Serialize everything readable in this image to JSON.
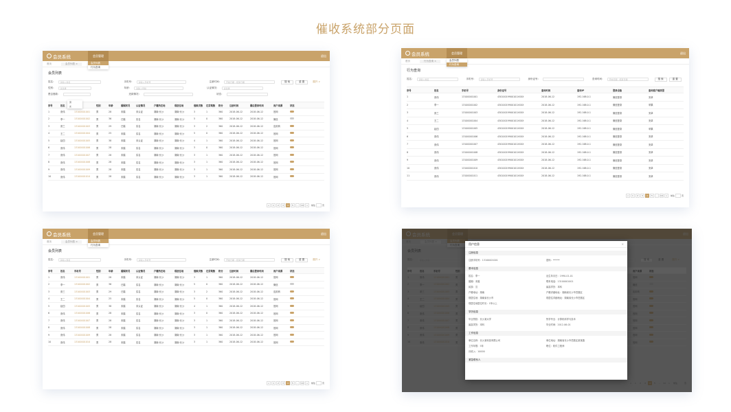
{
  "page_title": "催收系统部分页面",
  "app_name": "会员系统",
  "nav_label": "会员管理",
  "menu": [
    "会员列表",
    "行为查询"
  ],
  "header_right": "退出",
  "tabs": [
    "首页",
    "会员列表 ×"
  ],
  "tabs2": [
    "首页",
    "行为查询 ×"
  ],
  "list_title": "会员列表",
  "behavior_title": "行为查询",
  "filters": {
    "name": "姓名：",
    "name_ph": "请输入姓名",
    "phone": "手机号：",
    "phone_ph": "请输入手机号",
    "reg_time": "注册时间：",
    "reg_ph": "开始日期 - 结束日期",
    "gender": "性别：",
    "gender_ph": "请选择",
    "age": "年龄：",
    "age_ph": "请输入年龄",
    "auth": "认证情况：",
    "auth_ph": "请选择",
    "loan": "是否借款：",
    "repay": "还款情况：",
    "status": "状态：",
    "search": "搜 索",
    "reset": "重 置",
    "expand": "展开 ∨",
    "idcard": "身份证号：",
    "query_time": "查询时间：",
    "query": "查询"
  },
  "gender_opts": [
    "男",
    "女"
  ],
  "columns": [
    "序号",
    "姓名",
    "手机号",
    "性别",
    "年龄",
    "婚姻状况",
    "认证情况",
    "户籍所在地",
    "现居住地",
    "借款次数",
    "在贷笔数",
    "积分",
    "注册时间",
    "最后登录时间",
    "用户来源",
    "状态"
  ],
  "rows": [
    [
      "1",
      "张伟",
      "13100001001",
      "男",
      "28",
      "未婚",
      "未认证",
      "湖南·长沙",
      "湖南·长沙",
      "3",
      "1",
      "360",
      "2018-06-12",
      "2018-06-12",
      "官网",
      "on"
    ],
    [
      "2",
      "李一",
      "13100001002",
      "男",
      "36",
      "已婚",
      "实名",
      "湖南·长沙",
      "湖南·长沙",
      "5",
      "0",
      "360",
      "2018-06-12",
      "2018-06-12",
      "微信",
      "off"
    ],
    [
      "3",
      "张三",
      "13100001003",
      "男",
      "29",
      "已婚",
      "实名",
      "湖南·长沙",
      "湖南·长沙",
      "3",
      "2",
      "360",
      "2018-06-12",
      "2018-06-12",
      "应用商",
      "on"
    ],
    [
      "4",
      "王二",
      "13100001004",
      "男",
      "25",
      "未婚",
      "实名",
      "湖南·长沙",
      "湖南·长沙",
      "5",
      "0",
      "360",
      "2018-06-12",
      "2018-06-12",
      "官网",
      "on"
    ],
    [
      "5",
      "赵四",
      "13100001005",
      "男",
      "38",
      "未婚",
      "未认证",
      "湖南·长沙",
      "湖南·长沙",
      "4",
      "1",
      "360",
      "2018-06-12",
      "2018-06-12",
      "官网",
      "on"
    ],
    [
      "6",
      "张伟",
      "13100001006",
      "男",
      "28",
      "未婚",
      "实名",
      "湖南·长沙",
      "湖南·长沙",
      "3",
      "0",
      "360",
      "2018-06-12",
      "2018-06-12",
      "官网",
      "on"
    ],
    [
      "7",
      "张伟",
      "13100001007",
      "男",
      "28",
      "未婚",
      "实名",
      "湖南·长沙",
      "湖南·长沙",
      "3",
      "1",
      "360",
      "2018-06-12",
      "2018-06-12",
      "官网",
      "on"
    ],
    [
      "8",
      "张伟",
      "13100001008",
      "男",
      "28",
      "未婚",
      "实名",
      "湖南·长沙",
      "湖南·长沙",
      "3",
      "1",
      "360",
      "2018-06-12",
      "2018-06-12",
      "官网",
      "on"
    ],
    [
      "9",
      "张伟",
      "13100001009",
      "男",
      "28",
      "未婚",
      "实名",
      "湖南·长沙",
      "湖南·长沙",
      "3",
      "1",
      "360",
      "2018-06-12",
      "2018-06-12",
      "官网",
      "on"
    ],
    [
      "10",
      "张伟",
      "13100001010",
      "男",
      "28",
      "未婚",
      "实名",
      "湖南·长沙",
      "湖南·长沙",
      "3",
      "1",
      "360",
      "2018-06-12",
      "2018-06-12",
      "官网",
      "on"
    ]
  ],
  "b_columns": [
    "序号",
    "姓名",
    "手机号",
    "身份证号",
    "查询时间",
    "查询IP",
    "登录设备",
    "查询客户端类型"
  ],
  "b_rows": [
    [
      "1",
      "张伟",
      "13100001001",
      "43010019900101XXXX",
      "2018-06-12",
      "192.168.0.1",
      "微信登录",
      "安卓"
    ],
    [
      "2",
      "李一",
      "13100001002",
      "43010019900101XXXX",
      "2018-06-12",
      "192.168.0.1",
      "微信登录",
      "苹果"
    ],
    [
      "3",
      "张三",
      "13100001003",
      "43010019900101XXXX",
      "2018-06-12",
      "192.168.0.1",
      "微信登录",
      "安卓"
    ],
    [
      "4",
      "王二",
      "13100001004",
      "43010019900101XXXX",
      "2018-06-12",
      "192.168.0.1",
      "微信登录",
      "安卓"
    ],
    [
      "5",
      "赵四",
      "13100001005",
      "43010019900101XXXX",
      "2018-06-12",
      "192.168.0.1",
      "微信登录",
      "苹果"
    ],
    [
      "6",
      "张伟",
      "13100001006",
      "43010019900101XXXX",
      "2018-06-12",
      "192.168.0.1",
      "微信登录",
      "安卓"
    ],
    [
      "7",
      "张伟",
      "13100001007",
      "43010019900101XXXX",
      "2018-06-12",
      "192.168.0.1",
      "微信登录",
      "安卓"
    ],
    [
      "8",
      "张伟",
      "13100001008",
      "43010019900101XXXX",
      "2018-06-12",
      "192.168.0.1",
      "微信登录",
      "安卓"
    ],
    [
      "9",
      "张伟",
      "13100001009",
      "43010019900101XXXX",
      "2018-06-12",
      "192.168.0.1",
      "微信登录",
      "安卓"
    ],
    [
      "10",
      "张伟",
      "13100001010",
      "43010019900101XXXX",
      "2018-06-12",
      "192.168.0.1",
      "微信登录",
      "安卓"
    ],
    [
      "11",
      "张伟",
      "13100001011",
      "43010019900101XXXX",
      "2018-06-12",
      "192.168.0.1",
      "微信登录",
      "安卓"
    ]
  ],
  "pager": [
    "<",
    "1",
    "2",
    "3",
    "4",
    "5",
    "...",
    "10",
    ">"
  ],
  "pager_goto": "前往",
  "pager_page": "页",
  "pager_current": "4",
  "modal": {
    "title": "用户信息",
    "sections": [
      {
        "name": "注册信息",
        "items": [
          "注册手机号：13100001001",
          "密码：******"
        ]
      },
      {
        "name": "基本信息",
        "items": [
          "姓名：李一",
          "出生年月日：1990-01-01",
          "婚姻：未婚",
          "联系电话：13100001001",
          "民族：汉",
          "最高学历：本科",
          "户籍地址：湖南",
          "户籍详细地址：湖南省长沙市岳麓区",
          "现居住地：湖南省长沙市",
          "现居住详细地址：湖南省长沙市岳麓区",
          "现居住地居住时长：1年以上",
          ""
        ]
      },
      {
        "name": "学历信息",
        "items": [
          "毕业院校：长沙某大学",
          "所学专业：计算机科学与技术",
          "最高学历：本科",
          "毕业时间：2012-06-01"
        ]
      },
      {
        "name": "工作信息",
        "items": [
          "单位名称：长沙某科技有限公司",
          "单位地址：湖南省长沙市岳麓区某某路",
          "工作年限：5年",
          "职位：软件工程师",
          "月收入：10000"
        ]
      },
      {
        "name": "紧急联系人",
        "items": []
      }
    ]
  },
  "colors": {
    "accent": "#c9a36a",
    "accent_dark": "#b48c52"
  }
}
